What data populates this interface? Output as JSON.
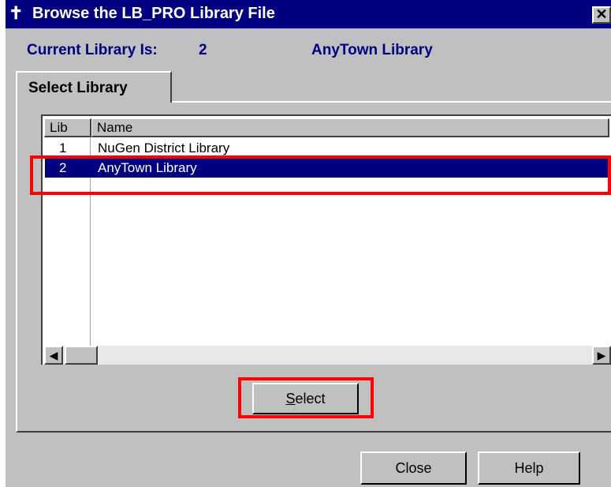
{
  "window": {
    "title": "Browse the LB_PRO Library File",
    "close_glyph": "✕"
  },
  "current_library": {
    "label": "Current Library Is:",
    "number": "2",
    "name": "AnyTown Library"
  },
  "tab": {
    "label": "Select Library"
  },
  "list": {
    "columns": [
      "Lib",
      "Name"
    ],
    "rows": [
      {
        "lib": "1",
        "name": "NuGen District Library"
      },
      {
        "lib": "2",
        "name": "AnyTown Library"
      }
    ],
    "selected_index": 1
  },
  "buttons": {
    "select_prefix": "S",
    "select_rest": "elect",
    "close": "Close",
    "help": "Help"
  },
  "colors": {
    "titlebar": "#000080",
    "highlight": "#ff0000",
    "selection": "#000080",
    "face": "#c0c0c0"
  }
}
